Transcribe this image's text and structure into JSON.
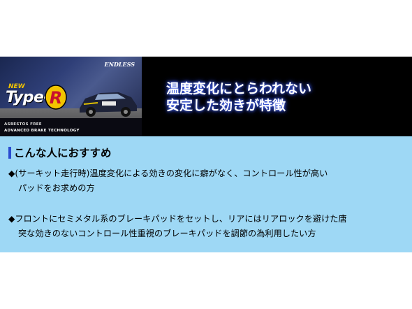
{
  "banner": {
    "product": {
      "brand": "ENDLESS",
      "logo_new": "NEW",
      "logo_type": "Type-",
      "logo_r": "R",
      "tagline_1": "ASBESTOS FREE",
      "tagline_2": "ADVANCED BRAKE TECHNOLOGY"
    },
    "headline_line_1": "温度変化にとらわれない",
    "headline_line_2": "安定した効きが特徴"
  },
  "panel": {
    "title": "こんな人におすすめ",
    "bullets": [
      {
        "line_1": "◆(サーキット走行時)温度変化による効きの変化に癖がなく、コントロール性が高い",
        "line_2": "パッドをお求めの方"
      },
      {
        "line_1": "◆フロントにセミメタル系のブレーキパッドをセットし、リアにはリアロックを避けた唐",
        "line_2": "突な効きのないコントロール性重視のブレーキパッドを調節の為利用したい方"
      }
    ]
  },
  "colors": {
    "banner_bg": "#000000",
    "panel_bg": "#9ed8f5",
    "headline_glow": "#4b6cff",
    "title_marker": "#2a4bd0",
    "logo_accent": "#f3c400"
  }
}
